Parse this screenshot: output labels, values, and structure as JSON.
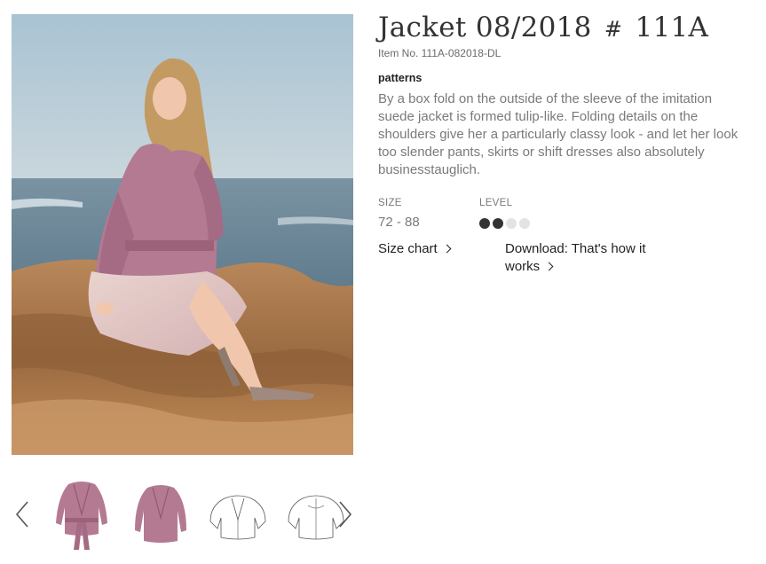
{
  "product": {
    "title": "Jacket 08/2018",
    "hash": "#",
    "number": "111A",
    "item_no": "Item No. 111A-082018-DL",
    "category": "patterns",
    "description": "By a box fold on the outside of the sleeve of the imitation suede jacket is formed tulip-like. Folding details on the shoulders give her a particularly classy look - and let her look too slender pants, skirts or shift dresses also absolutely businesstauglich."
  },
  "specs": {
    "size_label": "SIZE",
    "size_value": "72 - 88",
    "level_label": "LEVEL",
    "level": 2,
    "level_max": 4
  },
  "links": {
    "size_chart": "Size chart",
    "download": "Download: That's how it works"
  },
  "thumbnails": [
    "jacket-front-belted",
    "jacket-front",
    "technical-drawing-front",
    "technical-drawing-back"
  ],
  "colors": {
    "level_filled": "#333333",
    "level_empty": "#e3e3e3",
    "jacket": "#b47a92"
  }
}
